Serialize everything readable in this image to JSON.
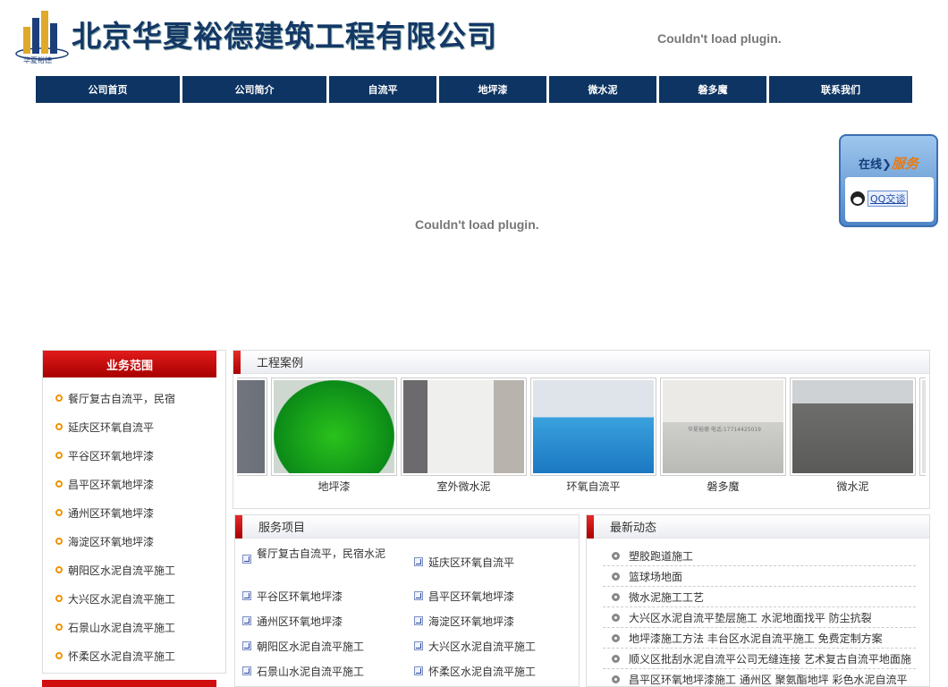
{
  "header": {
    "company_name": "北京华夏裕德建筑工程有限公司",
    "logo_text": "华夏裕德",
    "plugin_message_top": "Couldn't load plugin.",
    "plugin_message_center": "Couldn't load plugin."
  },
  "nav": [
    "公司首页",
    "公司简介",
    "自流平",
    "地坪漆",
    "微水泥",
    "磐多魔",
    "联系我们"
  ],
  "qq_widget": {
    "title_a": "在线",
    "title_b": "服务",
    "button": "QQ交谈"
  },
  "sidebar": {
    "title": "业务范围",
    "items": [
      "餐厅复古自流平，民宿",
      "延庆区环氧自流平",
      "平谷区环氧地坪漆",
      "昌平区环氧地坪漆",
      "通州区环氧地坪漆",
      "海淀区环氧地坪漆",
      "朝阳区水泥自流平施工",
      "大兴区水泥自流平施工",
      "石景山水泥自流平施工",
      "怀柔区水泥自流平施工"
    ]
  },
  "cases": {
    "title": "工程案例",
    "items": [
      "地坪漆",
      "室外微水泥",
      "环氧自流平",
      "磐多魔",
      "微水泥"
    ],
    "image_watermark": "华夏裕德 电话:17714425019"
  },
  "services": {
    "title": "服务项目",
    "items": [
      "餐厅复古自流平，民宿水泥",
      "延庆区环氧自流平",
      "平谷区环氧地坪漆",
      "昌平区环氧地坪漆",
      "通州区环氧地坪漆",
      "海淀区环氧地坪漆",
      "朝阳区水泥自流平施工",
      "大兴区水泥自流平施工",
      "石景山水泥自流平施工",
      "怀柔区水泥自流平施工"
    ]
  },
  "news": {
    "title": "最新动态",
    "items": [
      "塑胶跑道施工",
      "篮球场地面",
      "微水泥施工工艺",
      "大兴区水泥自流平垫层施工  水泥地面找平  防尘抗裂",
      "地坪漆施工方法  丰台区水泥自流平施工  免费定制方案",
      "顺义区批刮水泥自流平公司无缝连接  艺术复古自流平地面施",
      "昌平区环氧地坪漆施工  通州区  聚氨酯地坪  彩色水泥自流平"
    ]
  },
  "colors": {
    "nav_bg": "#0d3462",
    "accent_red": "#c40b0b",
    "title_blue": "#143866"
  }
}
